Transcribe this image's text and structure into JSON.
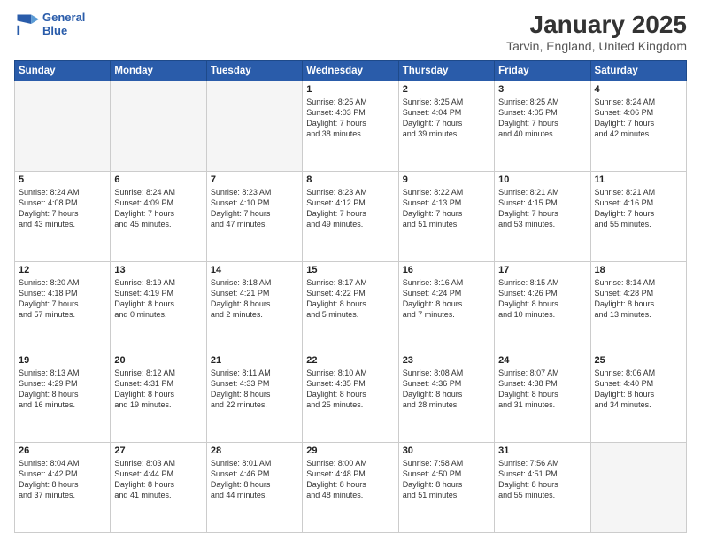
{
  "logo": {
    "line1": "General",
    "line2": "Blue"
  },
  "title": "January 2025",
  "subtitle": "Tarvin, England, United Kingdom",
  "days_of_week": [
    "Sunday",
    "Monday",
    "Tuesday",
    "Wednesday",
    "Thursday",
    "Friday",
    "Saturday"
  ],
  "weeks": [
    [
      {
        "num": "",
        "text": ""
      },
      {
        "num": "",
        "text": ""
      },
      {
        "num": "",
        "text": ""
      },
      {
        "num": "1",
        "text": "Sunrise: 8:25 AM\nSunset: 4:03 PM\nDaylight: 7 hours\nand 38 minutes."
      },
      {
        "num": "2",
        "text": "Sunrise: 8:25 AM\nSunset: 4:04 PM\nDaylight: 7 hours\nand 39 minutes."
      },
      {
        "num": "3",
        "text": "Sunrise: 8:25 AM\nSunset: 4:05 PM\nDaylight: 7 hours\nand 40 minutes."
      },
      {
        "num": "4",
        "text": "Sunrise: 8:24 AM\nSunset: 4:06 PM\nDaylight: 7 hours\nand 42 minutes."
      }
    ],
    [
      {
        "num": "5",
        "text": "Sunrise: 8:24 AM\nSunset: 4:08 PM\nDaylight: 7 hours\nand 43 minutes."
      },
      {
        "num": "6",
        "text": "Sunrise: 8:24 AM\nSunset: 4:09 PM\nDaylight: 7 hours\nand 45 minutes."
      },
      {
        "num": "7",
        "text": "Sunrise: 8:23 AM\nSunset: 4:10 PM\nDaylight: 7 hours\nand 47 minutes."
      },
      {
        "num": "8",
        "text": "Sunrise: 8:23 AM\nSunset: 4:12 PM\nDaylight: 7 hours\nand 49 minutes."
      },
      {
        "num": "9",
        "text": "Sunrise: 8:22 AM\nSunset: 4:13 PM\nDaylight: 7 hours\nand 51 minutes."
      },
      {
        "num": "10",
        "text": "Sunrise: 8:21 AM\nSunset: 4:15 PM\nDaylight: 7 hours\nand 53 minutes."
      },
      {
        "num": "11",
        "text": "Sunrise: 8:21 AM\nSunset: 4:16 PM\nDaylight: 7 hours\nand 55 minutes."
      }
    ],
    [
      {
        "num": "12",
        "text": "Sunrise: 8:20 AM\nSunset: 4:18 PM\nDaylight: 7 hours\nand 57 minutes."
      },
      {
        "num": "13",
        "text": "Sunrise: 8:19 AM\nSunset: 4:19 PM\nDaylight: 8 hours\nand 0 minutes."
      },
      {
        "num": "14",
        "text": "Sunrise: 8:18 AM\nSunset: 4:21 PM\nDaylight: 8 hours\nand 2 minutes."
      },
      {
        "num": "15",
        "text": "Sunrise: 8:17 AM\nSunset: 4:22 PM\nDaylight: 8 hours\nand 5 minutes."
      },
      {
        "num": "16",
        "text": "Sunrise: 8:16 AM\nSunset: 4:24 PM\nDaylight: 8 hours\nand 7 minutes."
      },
      {
        "num": "17",
        "text": "Sunrise: 8:15 AM\nSunset: 4:26 PM\nDaylight: 8 hours\nand 10 minutes."
      },
      {
        "num": "18",
        "text": "Sunrise: 8:14 AM\nSunset: 4:28 PM\nDaylight: 8 hours\nand 13 minutes."
      }
    ],
    [
      {
        "num": "19",
        "text": "Sunrise: 8:13 AM\nSunset: 4:29 PM\nDaylight: 8 hours\nand 16 minutes."
      },
      {
        "num": "20",
        "text": "Sunrise: 8:12 AM\nSunset: 4:31 PM\nDaylight: 8 hours\nand 19 minutes."
      },
      {
        "num": "21",
        "text": "Sunrise: 8:11 AM\nSunset: 4:33 PM\nDaylight: 8 hours\nand 22 minutes."
      },
      {
        "num": "22",
        "text": "Sunrise: 8:10 AM\nSunset: 4:35 PM\nDaylight: 8 hours\nand 25 minutes."
      },
      {
        "num": "23",
        "text": "Sunrise: 8:08 AM\nSunset: 4:36 PM\nDaylight: 8 hours\nand 28 minutes."
      },
      {
        "num": "24",
        "text": "Sunrise: 8:07 AM\nSunset: 4:38 PM\nDaylight: 8 hours\nand 31 minutes."
      },
      {
        "num": "25",
        "text": "Sunrise: 8:06 AM\nSunset: 4:40 PM\nDaylight: 8 hours\nand 34 minutes."
      }
    ],
    [
      {
        "num": "26",
        "text": "Sunrise: 8:04 AM\nSunset: 4:42 PM\nDaylight: 8 hours\nand 37 minutes."
      },
      {
        "num": "27",
        "text": "Sunrise: 8:03 AM\nSunset: 4:44 PM\nDaylight: 8 hours\nand 41 minutes."
      },
      {
        "num": "28",
        "text": "Sunrise: 8:01 AM\nSunset: 4:46 PM\nDaylight: 8 hours\nand 44 minutes."
      },
      {
        "num": "29",
        "text": "Sunrise: 8:00 AM\nSunset: 4:48 PM\nDaylight: 8 hours\nand 48 minutes."
      },
      {
        "num": "30",
        "text": "Sunrise: 7:58 AM\nSunset: 4:50 PM\nDaylight: 8 hours\nand 51 minutes."
      },
      {
        "num": "31",
        "text": "Sunrise: 7:56 AM\nSunset: 4:51 PM\nDaylight: 8 hours\nand 55 minutes."
      },
      {
        "num": "",
        "text": ""
      }
    ]
  ]
}
